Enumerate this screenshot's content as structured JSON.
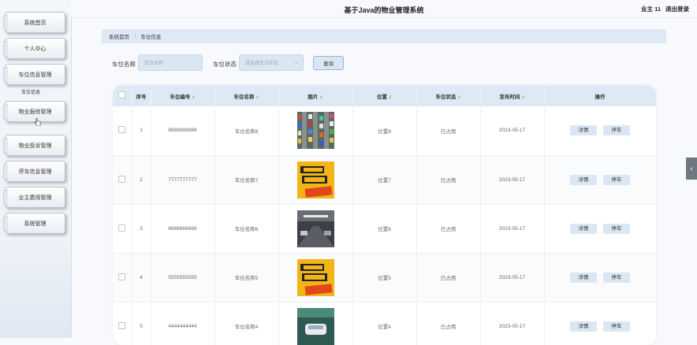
{
  "app_title": "基于Java的物业管理系统",
  "user": {
    "name": "业主 11",
    "logout": "退出登录"
  },
  "sidebar": {
    "items": [
      {
        "label": "系统首页"
      },
      {
        "label": "个人中心"
      },
      {
        "label": "车位信息管理"
      },
      {
        "label": "物业报修管理"
      },
      {
        "label": "物业投诉管理"
      },
      {
        "label": "停车信息管理"
      },
      {
        "label": "业主费用管理"
      },
      {
        "label": "系统管理"
      }
    ],
    "submenu_label": "车位信息"
  },
  "breadcrumb": {
    "home": "系统首页",
    "current": "车位信息"
  },
  "search": {
    "name_label": "车位名称",
    "name_placeholder": "车位名称",
    "status_label": "车位状态",
    "status_placeholder": "请选择车位状态",
    "query_button": "查询"
  },
  "table": {
    "headers": [
      "序号",
      "车位编号",
      "车位名称",
      "图片",
      "位置",
      "车位状态",
      "发布时间",
      "操作"
    ],
    "rows": [
      {
        "index": "1",
        "code": "8888888888",
        "name": "车位名称8",
        "image": "parking-lot-aerial",
        "location": "位置8",
        "status": "已占用",
        "date": "2023-05-17"
      },
      {
        "index": "2",
        "code": "7777777777",
        "name": "车位名称7",
        "image": "parking-sign-yellow",
        "location": "位置7",
        "status": "已占用",
        "date": "2023-05-17"
      },
      {
        "index": "3",
        "code": "6666666666",
        "name": "车位名称6",
        "image": "underground-garage",
        "location": "位置6",
        "status": "已占用",
        "date": "2023-05-17"
      },
      {
        "index": "4",
        "code": "5555555555",
        "name": "车位名称5",
        "image": "parking-sign-yellow",
        "location": "位置5",
        "status": "已占用",
        "date": "2023-05-17"
      },
      {
        "index": "5",
        "code": "4444444444",
        "name": "车位名称4",
        "image": "garage-car-green",
        "location": "位置4",
        "status": "已占用",
        "date": "2023-05-17"
      }
    ],
    "detail_button": "详情",
    "park_button": "停车"
  },
  "colors": {
    "accent": "#dbe6f3",
    "header_bg": "#dfe9f6"
  }
}
